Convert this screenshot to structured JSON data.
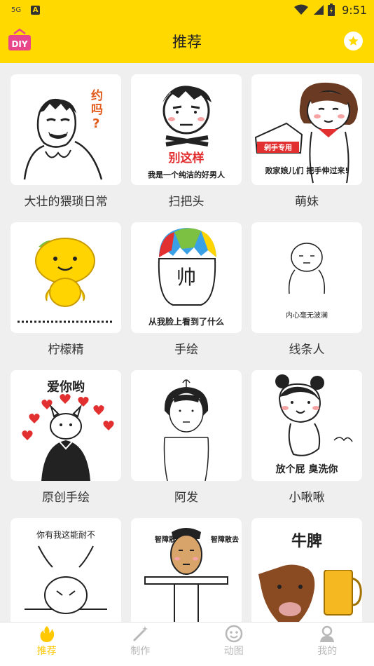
{
  "status_bar": {
    "network": "5G",
    "time": "9:51",
    "notification_letter": "A"
  },
  "header": {
    "title": "推荐",
    "logo_text": "DIY"
  },
  "cards": [
    {
      "label": "大壮的猥琐日常",
      "caption": "约吗?"
    },
    {
      "label": "扫把头",
      "caption": "别这样",
      "caption2": "我是一个纯洁的好男人"
    },
    {
      "label": "萌妹",
      "caption": "败家娘儿们 把手伸过来!",
      "badge": "剁手专用"
    },
    {
      "label": "柠檬精",
      "caption": ""
    },
    {
      "label": "手绘",
      "caption": "从我脸上看到了什么",
      "face_text": "帅"
    },
    {
      "label": "线条人",
      "caption": "内心毫无波澜"
    },
    {
      "label": "原创手绘",
      "caption": "爱你哟"
    },
    {
      "label": "阿发",
      "caption": ""
    },
    {
      "label": "小啾啾",
      "caption": "放个屁 臭洗你"
    },
    {
      "label": "",
      "caption": "你有我这能耐不"
    },
    {
      "label": "",
      "caption_left": "智障散去",
      "caption_right": "智障散去"
    },
    {
      "label": "",
      "caption": "牛脾"
    }
  ],
  "bottom_nav": [
    {
      "label": "推荐",
      "icon": "flame-icon",
      "active": true
    },
    {
      "label": "制作",
      "icon": "magic-wand-icon",
      "active": false
    },
    {
      "label": "动图",
      "icon": "smiley-icon",
      "active": false
    },
    {
      "label": "我的",
      "icon": "user-icon",
      "active": false
    }
  ],
  "colors": {
    "brand": "#ffd900",
    "active": "#ffc800",
    "inactive": "#b8b8b8"
  }
}
